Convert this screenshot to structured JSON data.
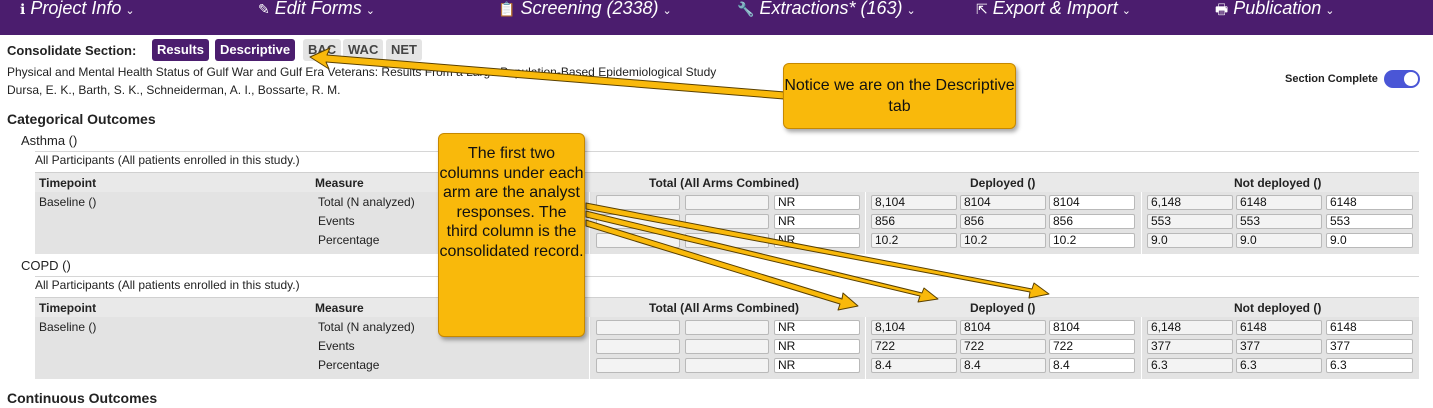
{
  "nav": [
    {
      "icon": "info-icon",
      "glyph": "ℹ",
      "label": "Project Info"
    },
    {
      "icon": "edit-icon",
      "glyph": "✎",
      "label": "Edit Forms"
    },
    {
      "icon": "clipboard-icon",
      "glyph": "📋",
      "label": "Screening (2338)"
    },
    {
      "icon": "wrench-icon",
      "glyph": "🔧",
      "label": "Extractions* (163)"
    },
    {
      "icon": "export-icon",
      "glyph": "⇱",
      "label": "Export & Import"
    },
    {
      "icon": "print-icon",
      "glyph": "🖶",
      "label": "Publication"
    }
  ],
  "chevron": "⌄",
  "consolidate_label": "Consolidate Section:",
  "tabs": [
    {
      "label": "Results",
      "active": true
    },
    {
      "label": "Descriptive",
      "active": true
    },
    {
      "label": "BAC",
      "active": false
    },
    {
      "label": "WAC",
      "active": false
    },
    {
      "label": "NET",
      "active": false
    }
  ],
  "study": {
    "title": "Physical and Mental Health Status of Gulf War and Gulf Era Veterans: Results From a Large Population-Based Epidemiological Study",
    "authors": "Dursa, E. K., Barth, S. K., Schneiderman, A. I., Bossarte, R. M."
  },
  "section_complete": {
    "label": "Section Complete",
    "on": true
  },
  "categorical_title": "Categorical Outcomes",
  "continuous_title": "Continuous Outcomes",
  "table_headers": {
    "timepoint": "Timepoint",
    "measure": "Measure",
    "total": "Total (All Arms Combined)",
    "deployed": "Deployed ()",
    "not_deployed": "Not deployed ()"
  },
  "outcomes": [
    {
      "name": "Asthma ()",
      "population": "All Participants (All patients enrolled in this study.)",
      "timepoint": "Baseline ()",
      "measures": [
        "Total (N analyzed)",
        "Events",
        "Percentage"
      ],
      "total": [
        [
          "",
          "",
          "NR"
        ],
        [
          "",
          "",
          "NR"
        ],
        [
          "",
          "",
          "NR"
        ]
      ],
      "deployed": [
        [
          "8,104",
          "8104",
          "8104"
        ],
        [
          "856",
          "856",
          "856"
        ],
        [
          "10.2",
          "10.2",
          "10.2"
        ]
      ],
      "not_deployed": [
        [
          "6,148",
          "6148",
          "6148"
        ],
        [
          "553",
          "553",
          "553"
        ],
        [
          "9.0",
          "9.0",
          "9.0"
        ]
      ]
    },
    {
      "name": "COPD ()",
      "population": "All Participants (All patients enrolled in this study.)",
      "timepoint": "Baseline ()",
      "measures": [
        "Total (N analyzed)",
        "Events",
        "Percentage"
      ],
      "total": [
        [
          "",
          "",
          "NR"
        ],
        [
          "",
          "",
          "NR"
        ],
        [
          "",
          "",
          "NR"
        ]
      ],
      "deployed": [
        [
          "8,104",
          "8104",
          "8104"
        ],
        [
          "722",
          "722",
          "722"
        ],
        [
          "8.4",
          "8.4",
          "8.4"
        ]
      ],
      "not_deployed": [
        [
          "6,148",
          "6148",
          "6148"
        ],
        [
          "377",
          "377",
          "377"
        ],
        [
          "6.3",
          "6.3",
          "6.3"
        ]
      ]
    }
  ],
  "callouts": {
    "tab_note": "Notice we are on the Descriptive tab",
    "columns_note": "The first two columns under each arm are the analyst responses. The third column is the consolidated record."
  },
  "colors": {
    "nav_bg": "#4b1d6e",
    "tab_active": "#4b1d6e",
    "toggle_on": "#4a56d6",
    "callout": "#f9b90b"
  }
}
